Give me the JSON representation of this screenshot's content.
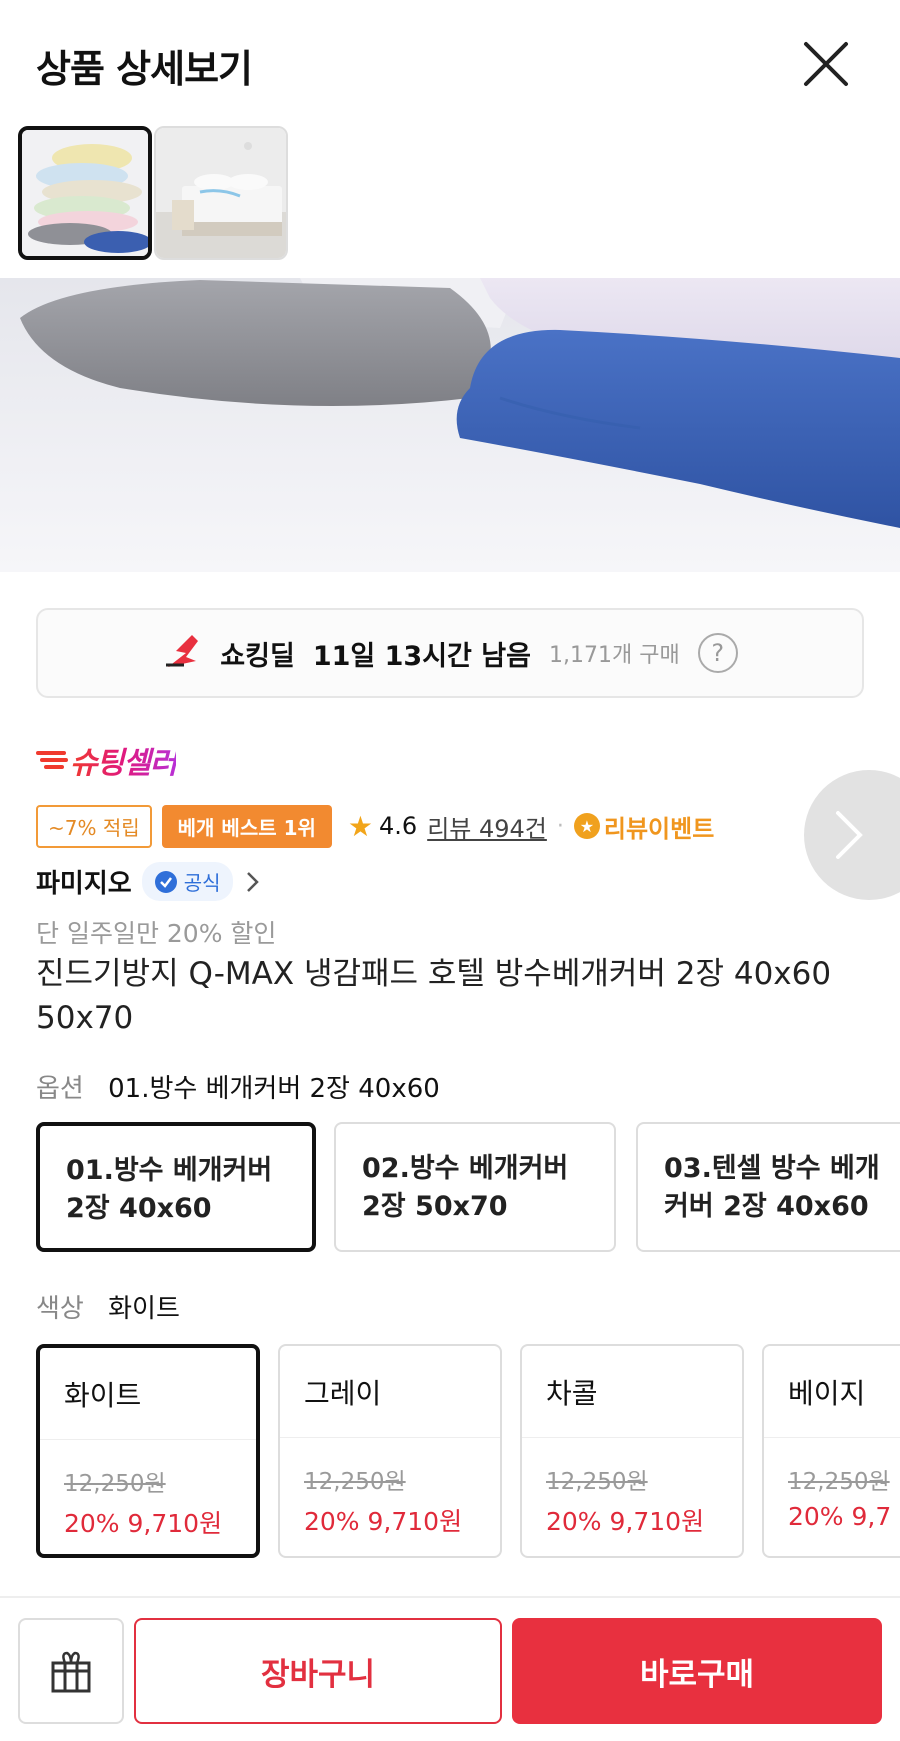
{
  "header": {
    "title": "상품 상세보기"
  },
  "deal": {
    "label": "쇼킹딜",
    "time_left": "11일 13시간 남음",
    "purchase_count": "1,171개 구매",
    "help_icon": "?"
  },
  "seller": {
    "logo_text": "슈팅셀러"
  },
  "badges": {
    "point": "~7% 적립",
    "best": "베개 베스트 1위",
    "rating": "4.6",
    "review": "리뷰 494건",
    "review_event": "리뷰이벤트"
  },
  "brand": {
    "name": "파미지오",
    "official": "공식"
  },
  "product": {
    "promo": "단 일주일만 20% 할인",
    "name": "진드기방지 Q-MAX 냉감패드 호텔 방수베개커버 2장 40x60 50x70"
  },
  "option": {
    "label": "옵션",
    "selected": "01.방수 베개커버 2장 40x60",
    "items": [
      {
        "line1": "01.방수 베개커버",
        "line2": "2장 40x60"
      },
      {
        "line1": "02.방수 베개커버",
        "line2": "2장 50x70"
      },
      {
        "line1": "03.텐셀 방수 베개",
        "line2": "커버 2장 40x60"
      }
    ]
  },
  "color": {
    "label": "색상",
    "selected": "화이트",
    "items": [
      {
        "name": "화이트",
        "original": "12,250원",
        "sale": "20% 9,710원"
      },
      {
        "name": "그레이",
        "original": "12,250원",
        "sale": "20% 9,710원"
      },
      {
        "name": "차콜",
        "original": "12,250원",
        "sale": "20% 9,710원"
      },
      {
        "name": "베이지",
        "original": "12,250원",
        "sale": "20% 9,7"
      }
    ]
  },
  "bottom": {
    "cart": "장바구니",
    "buy": "바로구매"
  },
  "colors": {
    "accent_red": "#e8303f",
    "orange": "#f28a30",
    "blue_official": "#2f6fd9"
  }
}
